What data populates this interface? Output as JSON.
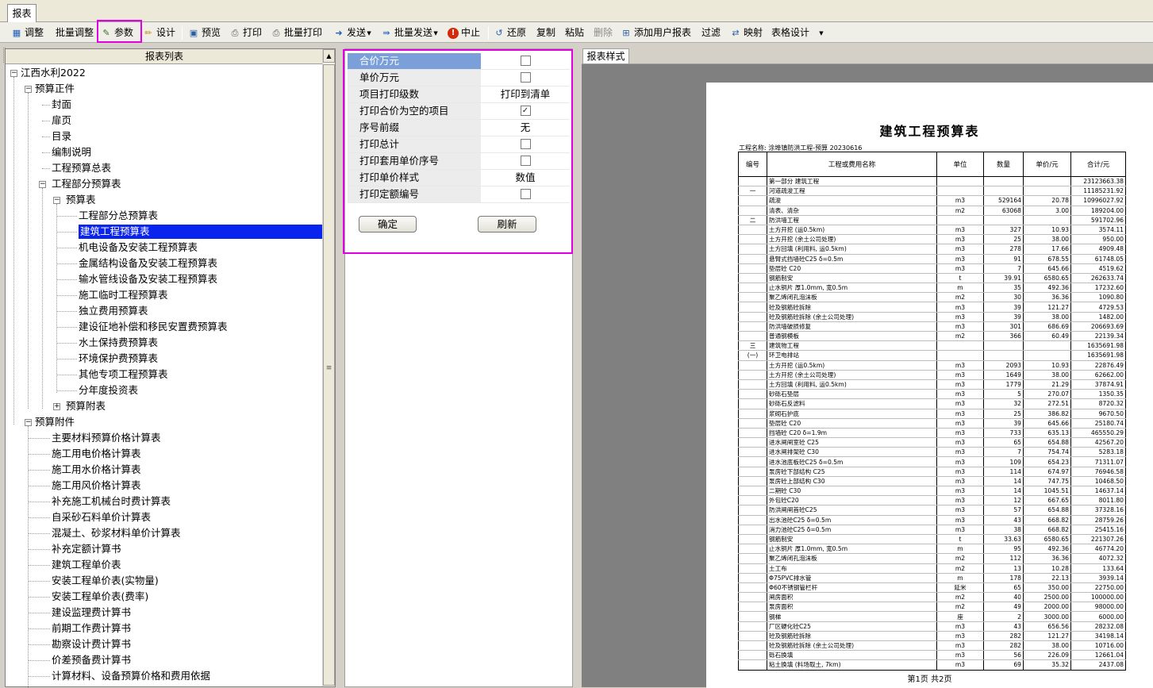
{
  "tab": "报表",
  "toolbar": {
    "adjust": "调整",
    "batch_adjust": "批量调整",
    "params": "参数",
    "design": "设计",
    "preview": "预览",
    "print": "打印",
    "batch_print": "批量打印",
    "send": "发送",
    "batch_send": "批量发送",
    "abort": "中止",
    "restore": "还原",
    "copy": "复制",
    "paste": "粘贴",
    "delete": "删除",
    "add_user_report": "添加用户报表",
    "filter": "过滤",
    "map": "映射",
    "table_design": "表格设计"
  },
  "tree": {
    "header": "报表列表",
    "root": "江西水利2022",
    "group1": "预算正件",
    "cover": "封面",
    "title_page": "扉页",
    "toc": "目录",
    "notes": "编制说明",
    "summary": "工程预算总表",
    "part_budget": "工程部分预算表",
    "budget_tables": "预算表",
    "items": [
      "工程部分总预算表",
      "建筑工程预算表",
      "机电设备及安装工程预算表",
      "金属结构设备及安装工程预算表",
      "输水管线设备及安装工程预算表",
      "施工临时工程预算表",
      "独立费用预算表",
      "建设征地补偿和移民安置费预算表",
      "水土保持费预算表",
      "环境保护费预算表",
      "其他专项工程预算表",
      "分年度投资表"
    ],
    "budget_appendix_tables": "预算附表",
    "group2": "预算附件",
    "attachments": [
      "主要材料预算价格计算表",
      "施工用电价格计算表",
      "施工用水价格计算表",
      "施工用风价格计算表",
      "补充施工机械台时费计算表",
      "自采砂石料单价计算表",
      "混凝土、砂浆材料单价计算表",
      "补充定额计算书",
      "建筑工程单价表",
      "安装工程单价表(实物量)",
      "安装工程单价表(费率)",
      "建设监理费计算书",
      "前期工作费计算书",
      "勘察设计费计算书",
      "价差预备费计算书",
      "计算材料、设备预算价格和费用依据"
    ]
  },
  "params": {
    "rows": [
      {
        "label": "合价万元",
        "type": "checkbox",
        "checked": false,
        "selected": true
      },
      {
        "label": "单价万元",
        "type": "checkbox",
        "checked": false
      },
      {
        "label": "项目打印级数",
        "type": "text",
        "value": "打印到清单"
      },
      {
        "label": "打印合价为空的项目",
        "type": "checkbox",
        "checked": true
      },
      {
        "label": "序号前缀",
        "type": "text",
        "value": "无"
      },
      {
        "label": "打印总计",
        "type": "checkbox",
        "checked": false
      },
      {
        "label": "打印套用单价序号",
        "type": "checkbox",
        "checked": false
      },
      {
        "label": "打印单价样式",
        "type": "text",
        "value": "数值"
      },
      {
        "label": "打印定额编号",
        "type": "checkbox",
        "checked": false
      }
    ],
    "ok": "确定",
    "refresh": "刷新"
  },
  "preview": {
    "tab": "报表样式",
    "title": "建筑工程预算表",
    "project": "工程名称: 涂埠镇防洪工程-预算 20230616",
    "headers": [
      "编号",
      "工程或费用名称",
      "单位",
      "数量",
      "单价/元",
      "合计/元"
    ],
    "rows": [
      [
        "",
        "第一部分 建筑工程",
        "",
        "",
        "",
        "23123663.38"
      ],
      [
        "一",
        "河道疏浚工程",
        "",
        "",
        "",
        "11185231.92"
      ],
      [
        "",
        "疏浚",
        "m3",
        "529164",
        "20.78",
        "10996027.92"
      ],
      [
        "",
        "清表、清杂",
        "m2",
        "63068",
        "3.00",
        "189204.00"
      ],
      [
        "二",
        "防洪墙工程",
        "",
        "",
        "",
        "591702.96"
      ],
      [
        "",
        "土方开挖 (运0.5km)",
        "m3",
        "327",
        "10.93",
        "3574.11"
      ],
      [
        "",
        "土方开挖 (余土公司处理)",
        "m3",
        "25",
        "38.00",
        "950.00"
      ],
      [
        "",
        "土方回填 (利用料, 运0.5km)",
        "m3",
        "278",
        "17.66",
        "4909.48"
      ],
      [
        "",
        "悬臂式挡墙砼C25 δ=0.5m",
        "m3",
        "91",
        "678.55",
        "61748.05"
      ],
      [
        "",
        "垫层砼 C20",
        "m3",
        "7",
        "645.66",
        "4519.62"
      ],
      [
        "",
        "钢筋制安",
        "t",
        "39.91",
        "6580.65",
        "262633.74"
      ],
      [
        "",
        "止水铜片 厚1.0mm, 宽0.5m",
        "m",
        "35",
        "492.36",
        "17232.60"
      ],
      [
        "",
        "聚乙烯闭孔泡沫板",
        "m2",
        "30",
        "36.36",
        "1090.80"
      ],
      [
        "",
        "砼及钢筋砼拆除",
        "m3",
        "39",
        "121.27",
        "4729.53"
      ],
      [
        "",
        "砼及钢筋砼拆除 (余土公司处理)",
        "m3",
        "39",
        "38.00",
        "1482.00"
      ],
      [
        "",
        "防洪墙破损修复",
        "m3",
        "301",
        "686.69",
        "206693.69"
      ],
      [
        "",
        "普通钢模板",
        "m2",
        "366",
        "60.49",
        "22139.34"
      ],
      [
        "三",
        "建筑物工程",
        "",
        "",
        "",
        "1635691.98"
      ],
      [
        "(一)",
        "环卫电排站",
        "",
        "",
        "",
        "1635691.98"
      ],
      [
        "",
        "土方开挖 (运0.5km)",
        "m3",
        "2093",
        "10.93",
        "22876.49"
      ],
      [
        "",
        "土方开挖 (余土公司处理)",
        "m3",
        "1649",
        "38.00",
        "62662.00"
      ],
      [
        "",
        "土方回填 (利用料, 运0.5km)",
        "m3",
        "1779",
        "21.29",
        "37874.91"
      ],
      [
        "",
        "砂砾石垫层",
        "m3",
        "5",
        "270.07",
        "1350.35"
      ],
      [
        "",
        "砂砾石反滤料",
        "m3",
        "32",
        "272.51",
        "8720.32"
      ],
      [
        "",
        "浆砌石护底",
        "m3",
        "25",
        "386.82",
        "9670.50"
      ],
      [
        "",
        "垫层砼 C20",
        "m3",
        "39",
        "645.66",
        "25180.74"
      ],
      [
        "",
        "挡墙砼 C20 δ=1.9m",
        "m3",
        "733",
        "635.13",
        "465550.29"
      ],
      [
        "",
        "进水闸闸室砼 C25",
        "m3",
        "65",
        "654.88",
        "42567.20"
      ],
      [
        "",
        "进水闸排架砼 C30",
        "m3",
        "7",
        "754.74",
        "5283.18"
      ],
      [
        "",
        "进水池底板砼C25 δ=0.5m",
        "m3",
        "109",
        "654.23",
        "71311.07"
      ],
      [
        "",
        "泵房砼下部结构 C25",
        "m3",
        "114",
        "674.97",
        "76946.58"
      ],
      [
        "",
        "泵房砼上部结构 C30",
        "m3",
        "14",
        "747.75",
        "10468.50"
      ],
      [
        "",
        "二期砼 C30",
        "m3",
        "14",
        "1045.51",
        "14637.14"
      ],
      [
        "",
        "外包砼C20",
        "m3",
        "12",
        "667.65",
        "8011.80"
      ],
      [
        "",
        "防洪闸闸首砼C25",
        "m3",
        "57",
        "654.88",
        "37328.16"
      ],
      [
        "",
        "出水池砼C25 δ=0.5m",
        "m3",
        "43",
        "668.82",
        "28759.26"
      ],
      [
        "",
        "消力池砼C25 δ=0.5m",
        "m3",
        "38",
        "668.82",
        "25415.16"
      ],
      [
        "",
        "钢筋制安",
        "t",
        "33.63",
        "6580.65",
        "221307.26"
      ],
      [
        "",
        "止水铜片 厚1.0mm, 宽0.5m",
        "m",
        "95",
        "492.36",
        "46774.20"
      ],
      [
        "",
        "聚乙烯闭孔泡沫板",
        "m2",
        "112",
        "36.36",
        "4072.32"
      ],
      [
        "",
        "土工布",
        "m2",
        "13",
        "10.28",
        "133.64"
      ],
      [
        "",
        "Φ75PVC排水管",
        "m",
        "178",
        "22.13",
        "3939.14"
      ],
      [
        "",
        "Φ60不锈钢管栏杆",
        "延米",
        "65",
        "350.00",
        "22750.00"
      ],
      [
        "",
        "闸房面积",
        "m2",
        "40",
        "2500.00",
        "100000.00"
      ],
      [
        "",
        "泵房面积",
        "m2",
        "49",
        "2000.00",
        "98000.00"
      ],
      [
        "",
        "钢梯",
        "座",
        "2",
        "3000.00",
        "6000.00"
      ],
      [
        "",
        "厂区硬化砼C25",
        "m3",
        "43",
        "656.56",
        "28232.08"
      ],
      [
        "",
        "砼及钢筋砼拆除",
        "m3",
        "282",
        "121.27",
        "34198.14"
      ],
      [
        "",
        "砼及钢筋砼拆除 (余土公司处理)",
        "m3",
        "282",
        "38.00",
        "10716.00"
      ],
      [
        "",
        "砾石换填",
        "m3",
        "56",
        "226.09",
        "12661.04"
      ],
      [
        "",
        "粘土换填 (料场取土, 7km)",
        "m3",
        "69",
        "35.32",
        "2437.08"
      ]
    ],
    "pager": "第1页 共2页"
  }
}
